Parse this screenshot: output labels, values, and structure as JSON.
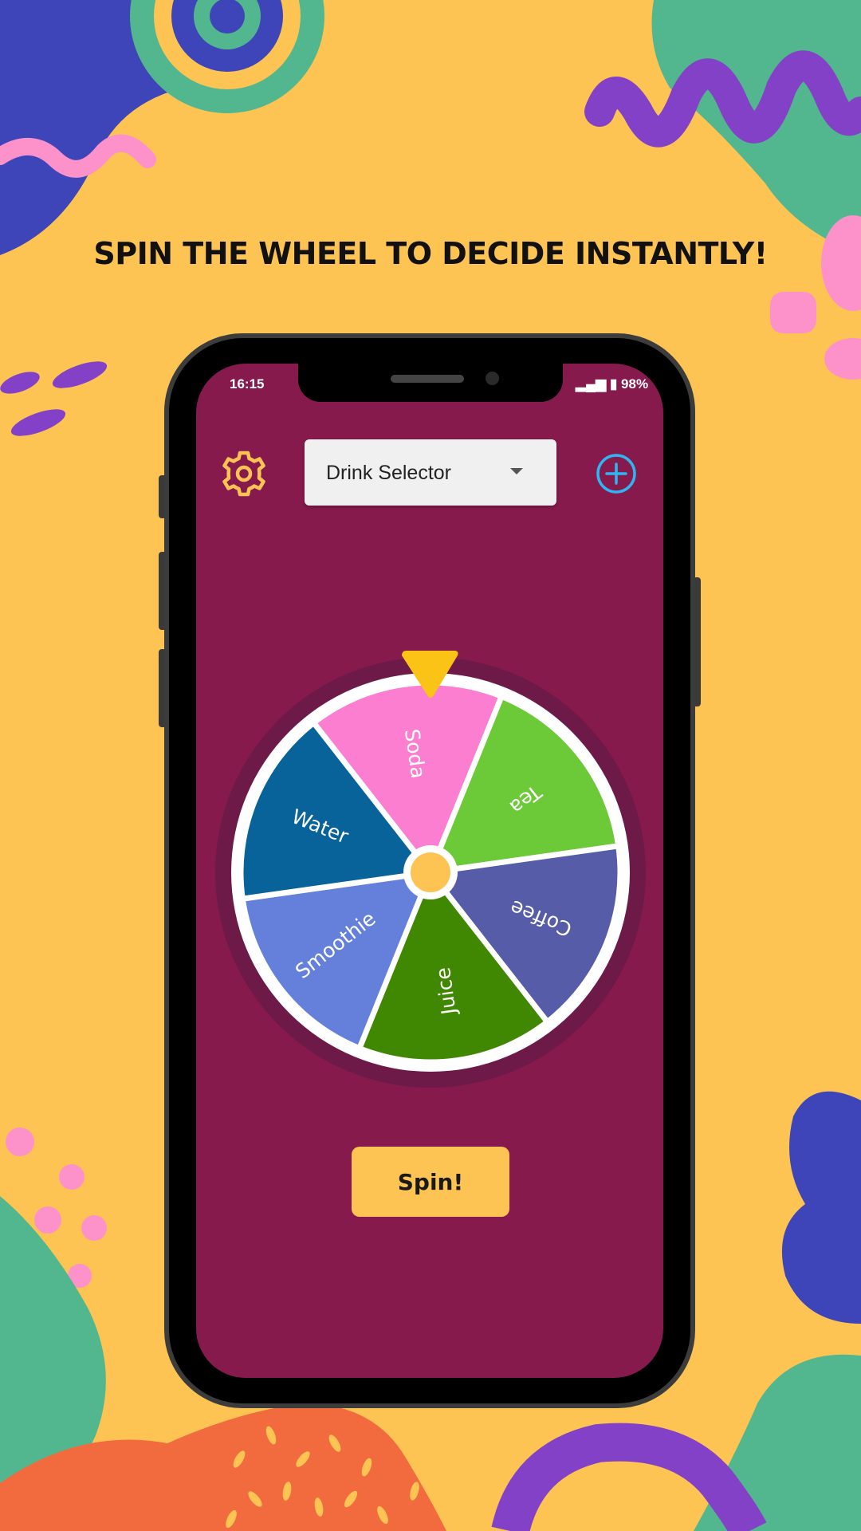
{
  "headline": "SPIN THE WHEEL TO DECIDE INSTANTLY!",
  "status_bar": {
    "time": "16:15",
    "battery": "98%"
  },
  "toolbar": {
    "settings_icon": "gear-icon",
    "selector_value": "Drink Selector",
    "add_icon": "plus-circle-icon"
  },
  "wheel": {
    "segments": [
      {
        "label": "Soda",
        "color": "#FB7ED0"
      },
      {
        "label": "Tea",
        "color": "#6CC937"
      },
      {
        "label": "Coffee",
        "color": "#575CA8"
      },
      {
        "label": "Juice",
        "color": "#408802"
      },
      {
        "label": "Smoothie",
        "color": "#6480DA"
      },
      {
        "label": "Water",
        "color": "#07639A"
      }
    ],
    "pointer_color": "#FBC316",
    "hub_color": "#FEC453"
  },
  "spin_button": "Spin!",
  "colors": {
    "background": "#FEC453",
    "screen": "#861A4D",
    "accent_blue": "#2FB6F2",
    "gear": "#FEC453"
  }
}
